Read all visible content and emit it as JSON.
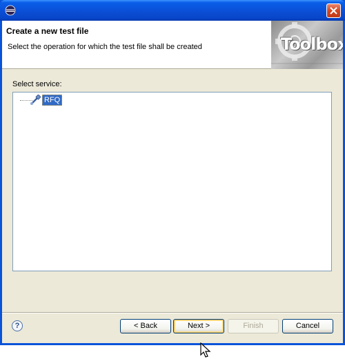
{
  "window": {
    "icon": "eclipse-icon",
    "close_icon": "close-icon"
  },
  "header": {
    "title": "Create a new test file",
    "description": "Select the operation for which the test file shall be created",
    "banner_text": "Toolbox"
  },
  "body": {
    "select_label": "Select service:",
    "tree": {
      "items": [
        {
          "label": "RFQ",
          "icon": "service-icon",
          "selected": true
        }
      ]
    }
  },
  "footer": {
    "help_icon": "help-icon",
    "help_glyph": "?",
    "back_label": "< Back",
    "next_label": "Next >",
    "finish_label": "Finish",
    "cancel_label": "Cancel"
  },
  "colors": {
    "titlebar": "#0a4fd6",
    "selection": "#316ac5",
    "dialog_bg": "#ece9d8"
  }
}
